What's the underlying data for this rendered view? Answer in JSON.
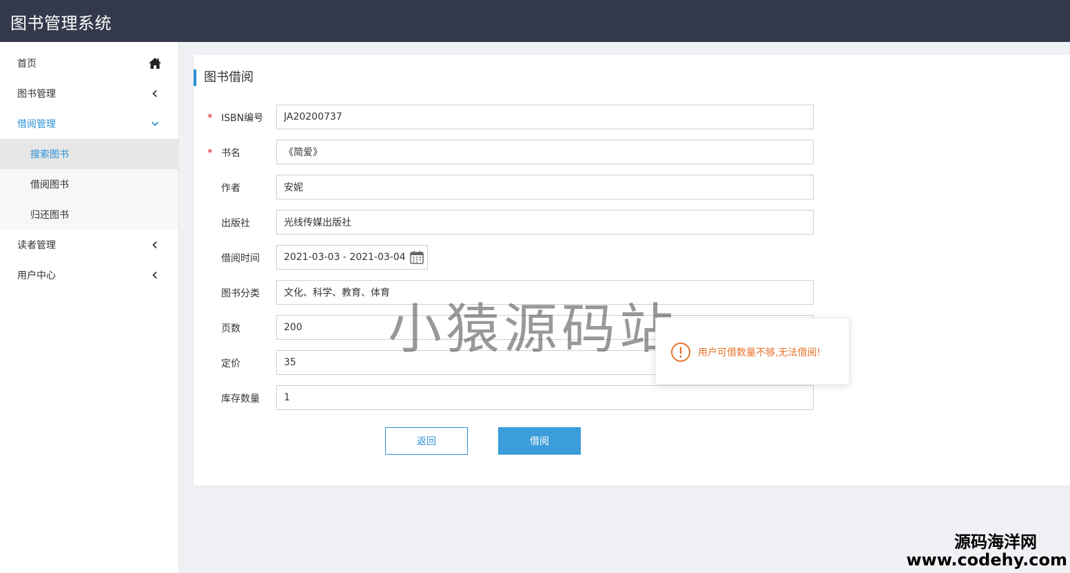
{
  "header": {
    "title": "图书管理系统"
  },
  "sidebar": {
    "items": [
      {
        "label": "首页",
        "icon": "home-icon"
      },
      {
        "label": "图书管理",
        "icon": "chevron-left-icon"
      },
      {
        "label": "借阅管理",
        "icon": "chevron-down-icon",
        "expanded": true,
        "children": [
          {
            "label": "搜索图书",
            "active": true
          },
          {
            "label": "借阅图书"
          },
          {
            "label": "归还图书"
          }
        ]
      },
      {
        "label": "读者管理",
        "icon": "chevron-left-icon"
      },
      {
        "label": "用户中心",
        "icon": "chevron-left-icon"
      }
    ]
  },
  "main": {
    "title": "图书借阅",
    "required_mark": "*",
    "fields": {
      "isbn": {
        "label": "ISBN编号",
        "value": "JA20200737",
        "required": true
      },
      "name": {
        "label": "书名",
        "value": "《简爱》",
        "required": true
      },
      "author": {
        "label": "作者",
        "value": "安妮"
      },
      "publisher": {
        "label": "出版社",
        "value": "光线传媒出版社"
      },
      "borrow_time": {
        "label": "借阅时间",
        "value": "2021-03-03 - 2021-03-04"
      },
      "category": {
        "label": "图书分类",
        "value": "文化、科学、教育、体育"
      },
      "pages": {
        "label": "页数",
        "value": "200"
      },
      "price": {
        "label": "定价",
        "value": "35"
      },
      "stock": {
        "label": "库存数量",
        "value": "1"
      }
    },
    "buttons": {
      "back": "返回",
      "borrow": "借阅"
    }
  },
  "toast": {
    "message": "用户可借数量不够,无法借阅!",
    "icon": "warning-icon"
  },
  "watermark": {
    "text": "小猿源码站"
  },
  "corner_watermark": {
    "line1": "源码海洋网",
    "line2": "www.codehy.com"
  },
  "colors": {
    "header_bg": "#343a4c",
    "accent": "#2b8fd6",
    "primary_button": "#3b9ddb",
    "warning": "#e6722a",
    "required": "#e02020"
  }
}
